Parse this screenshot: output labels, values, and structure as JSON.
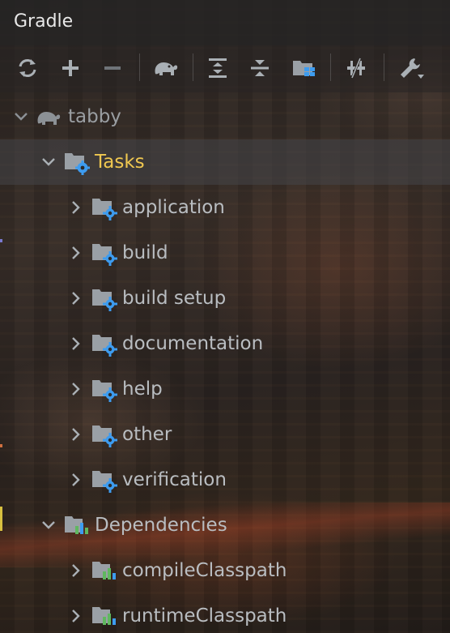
{
  "window": {
    "title": "Gradle"
  },
  "toolbar": {
    "buttons": [
      {
        "name": "refresh",
        "icon": "refresh-icon"
      },
      {
        "name": "add",
        "icon": "plus-icon"
      },
      {
        "name": "remove",
        "icon": "minus-icon"
      },
      {
        "name": "execute-task",
        "icon": "gradle-elephant-icon"
      },
      {
        "name": "expand-all",
        "icon": "expand-all-icon"
      },
      {
        "name": "collapse-all",
        "icon": "collapse-all-icon"
      },
      {
        "name": "group-modules",
        "icon": "folder-grid-icon"
      },
      {
        "name": "toggle-offline",
        "icon": "offline-icon"
      },
      {
        "name": "build-settings",
        "icon": "wrench-icon"
      }
    ]
  },
  "tree": {
    "project": {
      "label": "tabby",
      "icon": "gradle-elephant-icon"
    },
    "tasks": {
      "label": "Tasks",
      "icon": "folder-gear-icon",
      "children": [
        {
          "label": "application"
        },
        {
          "label": "build"
        },
        {
          "label": "build setup"
        },
        {
          "label": "documentation"
        },
        {
          "label": "help"
        },
        {
          "label": "other"
        },
        {
          "label": "verification"
        }
      ]
    },
    "dependencies": {
      "label": "Dependencies",
      "icon": "dependencies-icon",
      "children": [
        {
          "label": "compileClasspath"
        },
        {
          "label": "runtimeClasspath"
        }
      ]
    }
  },
  "colors": {
    "selected_text": "#f0c850",
    "text": "#b9bdc1",
    "icon_blue": "#3d9cf0",
    "icon_grey": "#9aa0a6",
    "bar_green": "#5fb85f"
  }
}
